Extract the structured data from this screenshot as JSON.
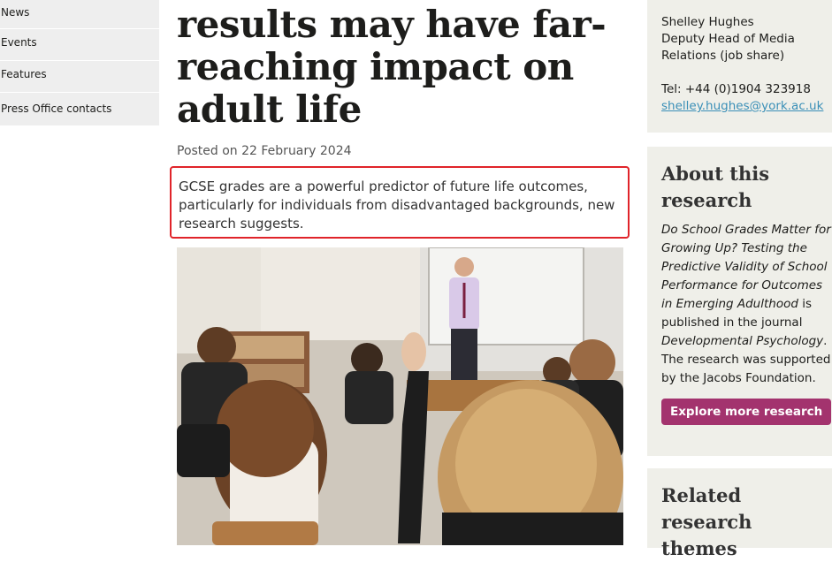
{
  "nav": {
    "items": [
      "News",
      "Events",
      "Features",
      "Press Office contacts"
    ]
  },
  "article": {
    "title": "results may have far-reaching impact on adult life",
    "posted": "Posted on 22 February 2024",
    "summary": "GCSE grades are a powerful predictor of future life outcomes, particularly for individuals from disadvantaged backgrounds, new research suggests."
  },
  "contact": {
    "name": "Shelley Hughes",
    "role": "Deputy Head of Media Relations (job share)",
    "tel": "Tel: +44 (0)1904 323918",
    "email": "shelley.hughes@york.ac.uk"
  },
  "about": {
    "heading": "About this research",
    "paper_title": "Do School Grades Matter for Growing Up? Testing the Predictive Validity of School Performance for Outcomes in Emerging Adulthood",
    "published_in": " is published in the journal ",
    "journal": "Developmental Psychology",
    "support": ". The research was supported by the Jacobs Foundation.",
    "button": "Explore more research"
  },
  "themes": {
    "heading": "Related research themes"
  },
  "colors": {
    "accent": "#a3336e",
    "link": "#3a8fb7",
    "highlight_border": "#e0242a",
    "sidebar_bg": "#efefe9"
  }
}
